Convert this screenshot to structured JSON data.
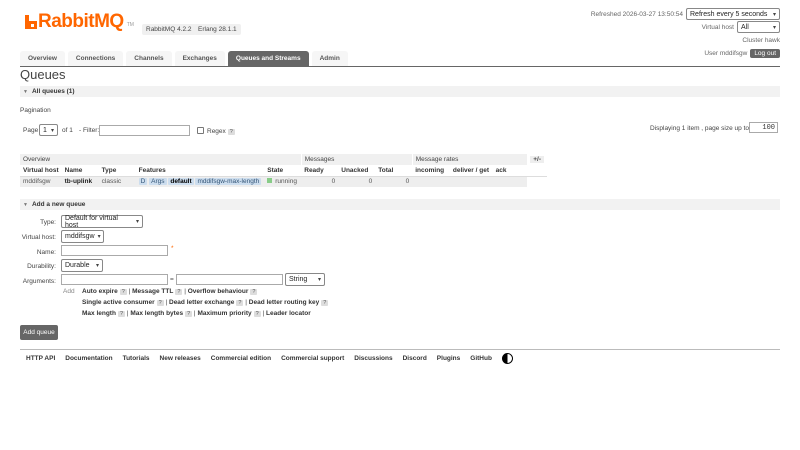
{
  "app": {
    "logo_text": "RabbitMQ",
    "logo_tm": "TM",
    "version": "RabbitMQ 4.2.2",
    "erlang": "Erlang 28.1.1",
    "accent": "#ff6600"
  },
  "header": {
    "refreshed": "Refreshed 2026-03-27 13:50:54",
    "refresh_select": "Refresh every 5 seconds",
    "vhost_label": "Virtual host",
    "vhost_value": "All",
    "cluster": "Cluster hawk",
    "user": "User mddifsgw",
    "logout": "Log out"
  },
  "tabs": [
    "Overview",
    "Connections",
    "Channels",
    "Exchanges",
    "Queues and Streams",
    "Admin"
  ],
  "page": {
    "title": "Queues",
    "all_queues": "All queues (1)"
  },
  "pagination": {
    "heading": "Pagination",
    "page_label": "Page",
    "page_value": "1",
    "of": "of 1",
    "filter_label": "- Filter:",
    "regex_label": "Regex",
    "help": "?",
    "displaying": "Displaying 1 item , page size up to:",
    "page_size": "100"
  },
  "table": {
    "groups": [
      "Overview",
      "Messages",
      "Message rates",
      "+/-"
    ],
    "columns": [
      "Virtual host",
      "Name",
      "Type",
      "Features",
      "State",
      "Ready",
      "Unacked",
      "Total",
      "incoming",
      "deliver / get",
      "ack"
    ],
    "rows": [
      {
        "vhost": "mddifsgw",
        "name": "tb-uplink",
        "type": "classic",
        "f1": "D",
        "f2": "Args",
        "f3": "default",
        "f4": "mddifsgw-max-length",
        "state": "running",
        "ready": "0",
        "unacked": "0",
        "total": "0",
        "incoming": "",
        "deliver": "",
        "ack": ""
      }
    ]
  },
  "add_queue": {
    "heading": "Add a new queue",
    "type_label": "Type:",
    "type_value": "Default for virtual host",
    "vhost_label": "Virtual host:",
    "vhost_value": "mddifsgw",
    "name_label": "Name:",
    "required_mark": "*",
    "durability_label": "Durability:",
    "durability_value": "Durable",
    "args_label": "Arguments:",
    "eq": "=",
    "arg_type": "String",
    "add": "Add",
    "arg_links": [
      [
        "Auto expire",
        "Message TTL",
        "Overflow behaviour"
      ],
      [
        "Single active consumer",
        "Dead letter exchange",
        "Dead letter routing key"
      ],
      [
        "Max length",
        "Max length bytes",
        "Maximum priority",
        "Leader locator"
      ]
    ],
    "submit": "Add queue"
  },
  "footer": [
    "HTTP API",
    "Documentation",
    "Tutorials",
    "New releases",
    "Commercial edition",
    "Commercial support",
    "Discussions",
    "Discord",
    "Plugins",
    "GitHub"
  ]
}
